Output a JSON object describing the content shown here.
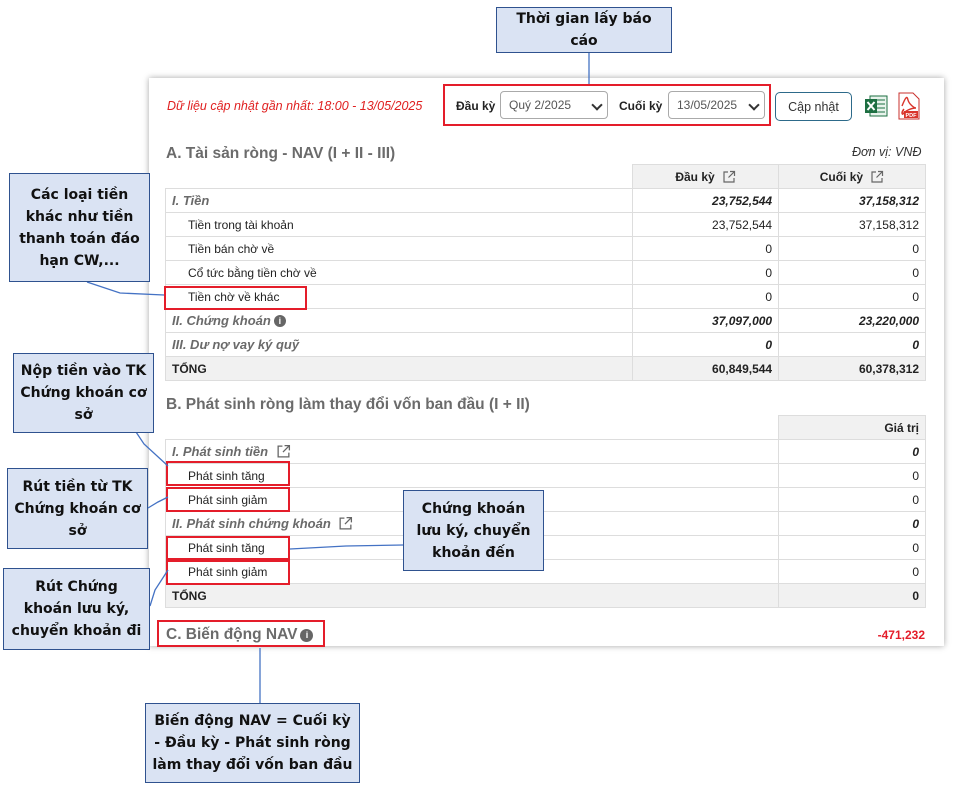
{
  "header": {
    "updated_text": "Dữ liệu cập nhật gần nhất: 18:00 - 13/05/2025",
    "start_label": "Đầu kỳ",
    "start_value": "Quý 2/2025",
    "end_label": "Cuối kỳ",
    "end_value": "13/05/2025",
    "update_button": "Cập nhật"
  },
  "section_a": {
    "title": "A. Tài sản ròng - NAV (I + II - III)",
    "unit": "Đơn vị: VNĐ",
    "col_start": "Đầu kỳ",
    "col_end": "Cuối kỳ",
    "rows": [
      {
        "label": "I. Tiền",
        "start": "23,752,544",
        "end": "37,158,312"
      },
      {
        "label": "Tiền trong tài khoản",
        "start": "23,752,544",
        "end": "37,158,312"
      },
      {
        "label": "Tiền bán chờ về",
        "start": "0",
        "end": "0"
      },
      {
        "label": "Cổ tức bằng tiền chờ về",
        "start": "0",
        "end": "0"
      },
      {
        "label": "Tiền chờ về khác",
        "start": "0",
        "end": "0"
      },
      {
        "label": "II. Chứng khoán",
        "start": "37,097,000",
        "end": "23,220,000"
      },
      {
        "label": "III. Dư nợ vay ký quỹ",
        "start": "0",
        "end": "0"
      },
      {
        "label": "TỔNG",
        "start": "60,849,544",
        "end": "60,378,312"
      }
    ]
  },
  "section_b": {
    "title": "B. Phát sinh ròng làm thay đổi vốn ban đầu (I + II)",
    "col_value": "Giá trị",
    "rows": [
      {
        "label": "I. Phát sinh tiền",
        "value": "0"
      },
      {
        "label": "Phát sinh tăng",
        "value": "0"
      },
      {
        "label": "Phát sinh giảm",
        "value": "0"
      },
      {
        "label": "II. Phát sinh chứng khoán",
        "value": "0"
      },
      {
        "label": "Phát sinh tăng",
        "value": "0"
      },
      {
        "label": "Phát sinh giảm",
        "value": "0"
      },
      {
        "label": "TỔNG",
        "value": "0"
      }
    ]
  },
  "section_c": {
    "title": "C. Biến động NAV",
    "value": "-471,232"
  },
  "callouts": {
    "report_time": "Thời gian lấy báo cáo",
    "other_cash": "Các loại tiền khác như tiền thanh toán đáo hạn CW,...",
    "deposit": "Nộp tiền vào TK Chứng khoán cơ sở",
    "withdraw": "Rút tiền từ TK Chứng khoán cơ sở",
    "securities_in": "Chứng khoán lưu ký, chuyển khoản đến",
    "securities_out": "Rút Chứng khoán lưu ký, chuyển khoản đi",
    "nav_formula": "Biến động NAV = Cuối kỳ - Đầu kỳ - Phát sinh ròng làm thay đổi vốn ban đầu"
  },
  "colors": {
    "accent_red": "#e41d2a",
    "callout_bg": "#dae3f3",
    "callout_border": "#2f528f",
    "negative_value": "#e41d2a"
  }
}
